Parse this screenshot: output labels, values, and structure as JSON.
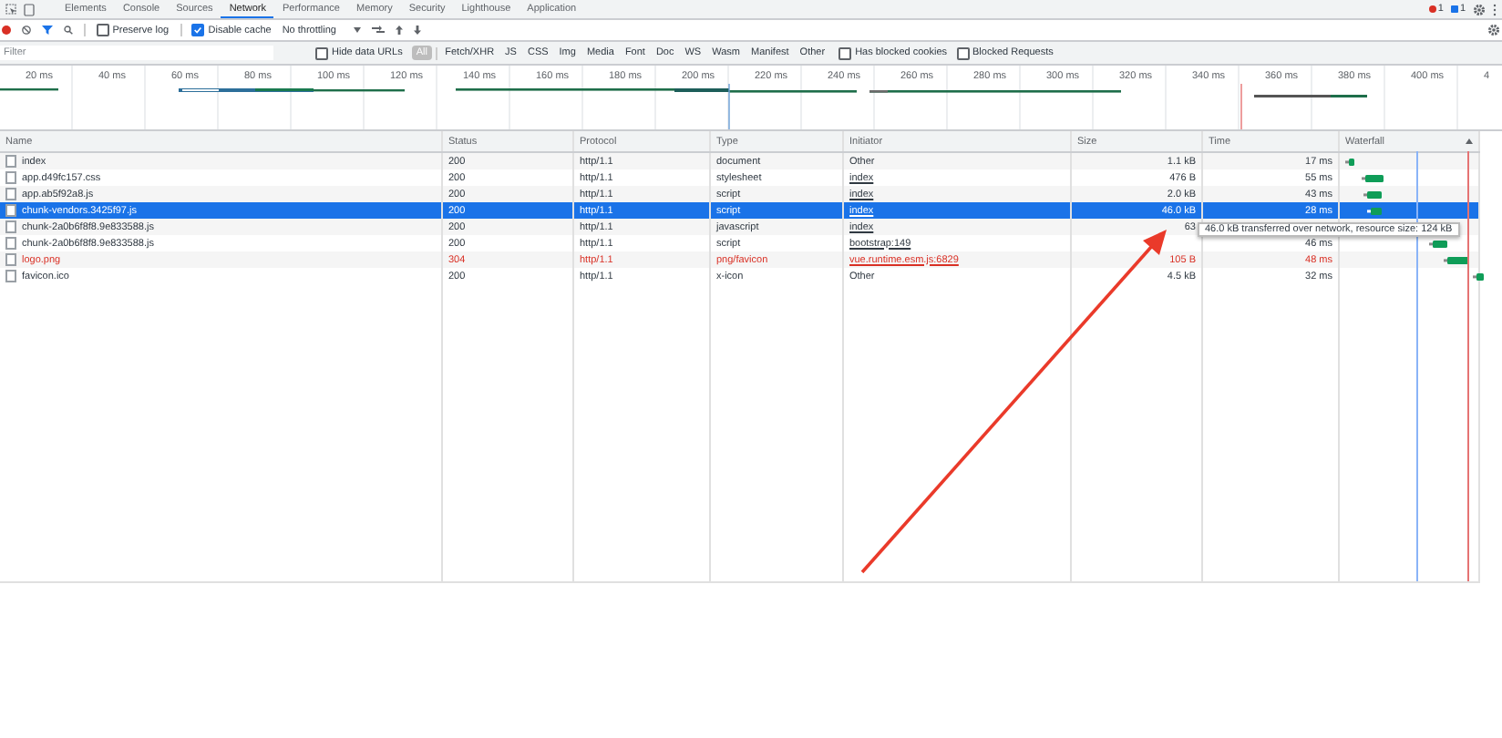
{
  "devtools_tabs": [
    {
      "label": "Elements",
      "selected": false
    },
    {
      "label": "Console",
      "selected": false
    },
    {
      "label": "Sources",
      "selected": false
    },
    {
      "label": "Network",
      "selected": true
    },
    {
      "label": "Performance",
      "selected": false
    },
    {
      "label": "Memory",
      "selected": false
    },
    {
      "label": "Security",
      "selected": false
    },
    {
      "label": "Lighthouse",
      "selected": false
    },
    {
      "label": "Application",
      "selected": false
    }
  ],
  "issues": {
    "errors": "1",
    "messages": "1"
  },
  "toolbar": {
    "recording": true,
    "preserve_log": {
      "label": "Preserve log",
      "checked": false
    },
    "disable_cache": {
      "label": "Disable cache",
      "checked": true
    },
    "throttling": "No throttling"
  },
  "filter": {
    "placeholder": "Filter",
    "hide_data_urls": {
      "label": "Hide data URLs",
      "checked": false
    },
    "types": [
      {
        "label": "All",
        "selected": true
      },
      {
        "label": "Fetch/XHR",
        "selected": false
      },
      {
        "label": "JS",
        "selected": false
      },
      {
        "label": "CSS",
        "selected": false
      },
      {
        "label": "Img",
        "selected": false
      },
      {
        "label": "Media",
        "selected": false
      },
      {
        "label": "Font",
        "selected": false
      },
      {
        "label": "Doc",
        "selected": false
      },
      {
        "label": "WS",
        "selected": false
      },
      {
        "label": "Wasm",
        "selected": false
      },
      {
        "label": "Manifest",
        "selected": false
      },
      {
        "label": "Other",
        "selected": false
      }
    ],
    "has_blocked_cookies": {
      "label": "Has blocked cookies",
      "checked": false
    },
    "blocked_requests": {
      "label": "Blocked Requests",
      "checked": false
    }
  },
  "overview": {
    "ticks": [
      "20 ms",
      "40 ms",
      "60 ms",
      "80 ms",
      "100 ms",
      "120 ms",
      "140 ms",
      "160 ms",
      "180 ms",
      "200 ms",
      "220 ms",
      "240 ms",
      "260 ms",
      "280 ms",
      "300 ms",
      "320 ms",
      "340 ms",
      "360 ms",
      "380 ms",
      "400 ms",
      "4"
    ]
  },
  "table": {
    "columns": [
      "Name",
      "Status",
      "Protocol",
      "Type",
      "Initiator",
      "Size",
      "Time",
      "Waterfall"
    ],
    "rows": [
      {
        "name": "index",
        "status": "200",
        "protocol": "http/1.1",
        "type": "document",
        "initiator": "Other",
        "initiator_link": false,
        "size": "1.1 kB",
        "time": "17 ms",
        "selected": false,
        "error": false
      },
      {
        "name": "app.d49fc157.css",
        "status": "200",
        "protocol": "http/1.1",
        "type": "stylesheet",
        "initiator": "index",
        "initiator_link": true,
        "size": "476 B",
        "time": "55 ms",
        "selected": false,
        "error": false
      },
      {
        "name": "app.ab5f92a8.js",
        "status": "200",
        "protocol": "http/1.1",
        "type": "script",
        "initiator": "index",
        "initiator_link": true,
        "size": "2.0 kB",
        "time": "43 ms",
        "selected": false,
        "error": false
      },
      {
        "name": "chunk-vendors.3425f97.js",
        "status": "200",
        "protocol": "http/1.1",
        "type": "script",
        "initiator": "index",
        "initiator_link": true,
        "size": "46.0 kB",
        "time": "28 ms",
        "selected": true,
        "error": false
      },
      {
        "name": "chunk-2a0b6f8f8.9e833588.js",
        "status": "200",
        "protocol": "http/1.1",
        "type": "javascript",
        "initiator": "index",
        "initiator_link": true,
        "size": "63",
        "selected": false,
        "error": false
      },
      {
        "name": "chunk-2a0b6f8f8.9e833588.js",
        "status": "200",
        "protocol": "http/1.1",
        "type": "script",
        "initiator": "bootstrap:149",
        "initiator_link": true,
        "time": "46 ms",
        "selected": false,
        "error": false
      },
      {
        "name": "logo.png",
        "status": "304",
        "protocol": "http/1.1",
        "type": "png/favicon",
        "initiator": "vue.runtime.esm.js:6829",
        "initiator_link": true,
        "size": "105 B",
        "time": "48 ms",
        "selected": false,
        "error": true
      },
      {
        "name": "favicon.ico",
        "status": "200",
        "protocol": "http/1.1",
        "type": "x-icon",
        "initiator": "Other",
        "initiator_link": false,
        "size": "4.5 kB",
        "time": "32 ms",
        "selected": false,
        "error": false
      }
    ]
  },
  "tooltip": "46.0 kB transferred over network, resource size: 124 kB"
}
